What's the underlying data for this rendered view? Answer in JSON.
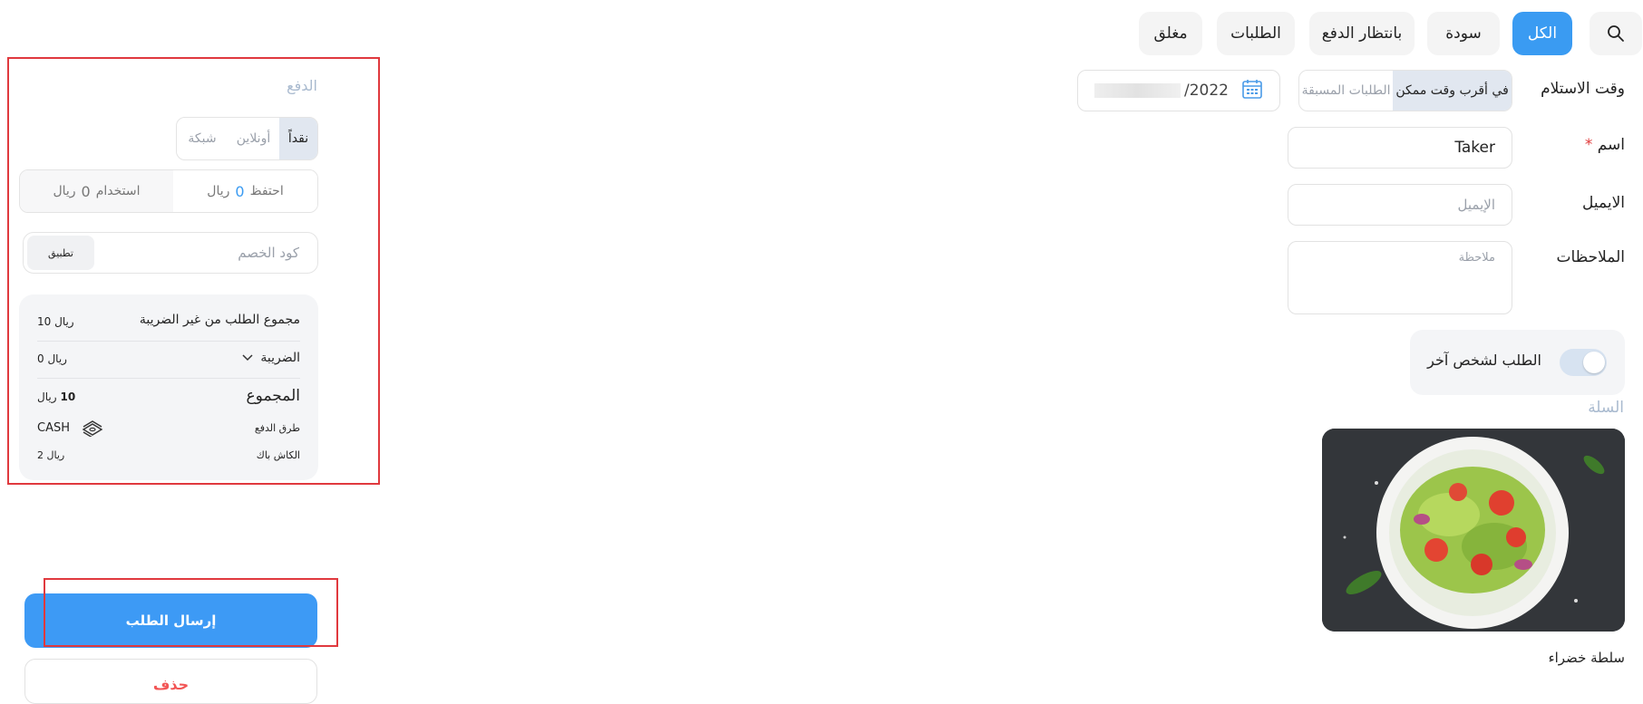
{
  "nav": {
    "search_icon": "search-icon",
    "tabs": [
      {
        "label": "الكل",
        "active": true
      },
      {
        "label": "سودة",
        "active": false
      },
      {
        "label": "بانتظار الدفع",
        "active": false
      },
      {
        "label": "الطلبات",
        "active": false
      },
      {
        "label": "مغلق",
        "active": false
      }
    ]
  },
  "form": {
    "pickup": {
      "label": "وقت الاستلام",
      "options": [
        "في أقرب وقت ممكن",
        "الطلبات المسبقة"
      ],
      "selected": "في أقرب وقت ممكن",
      "date_value": "2022/"
    },
    "name": {
      "label": "اسم",
      "required_mark": "*",
      "value": "Taker"
    },
    "email": {
      "label": "الايميل",
      "placeholder": "الإيميل"
    },
    "notes": {
      "label": "الملاحظات",
      "placeholder": "ملاحظة"
    },
    "order_for_other": {
      "label": "الطلب لشخص آخر",
      "enabled": false
    }
  },
  "basket": {
    "title": "السلة",
    "items": [
      {
        "name": "سلطة خضراء"
      }
    ]
  },
  "payment": {
    "title": "الدفع",
    "methods": [
      "نقداً",
      "أونلاين",
      "شبكة"
    ],
    "selected_method": "نقداً",
    "points": {
      "keep_label": "احتفظ",
      "keep_value": "0",
      "use_label": "استخدام",
      "use_value": "0",
      "currency": "ريال"
    },
    "coupon": {
      "placeholder": "كود الخصم",
      "apply_label": "تطبيق"
    },
    "summary": {
      "subtotal_label": "مجموع الطلب من غير الضريبة",
      "subtotal_value": "10 ريال",
      "tax_label": "الضريبة",
      "tax_value": "0 ريال",
      "total_label": "المجموع",
      "total_amount": "10",
      "total_currency": "ريال",
      "method_label": "طرق الدفع",
      "method_value": "CASH",
      "cashback_label": "الكاش باك",
      "cashback_value": "2 ريال"
    }
  },
  "actions": {
    "submit_label": "إرسال الطلب",
    "delete_label": "حذف"
  },
  "colors": {
    "accent": "#3a9bf2",
    "danger": "#f25555",
    "highlight_frame": "#e0393e"
  }
}
